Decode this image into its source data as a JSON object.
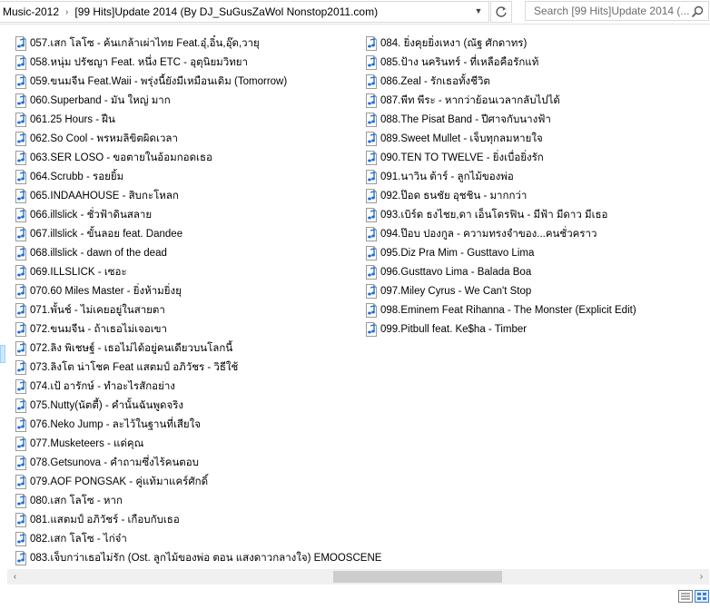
{
  "address": {
    "crumbs": [
      "Music-2012",
      "[99 Hits]Update 2014 (By DJ_SuGusZaWol Nonstop2011.com)"
    ],
    "separator": "›",
    "dropdown_icon": "chevron-down-icon",
    "refresh_icon": "refresh-icon"
  },
  "search": {
    "placeholder": "Search [99 Hits]Update 2014 (..."
  },
  "files_col1": [
    "057.เสก โลโซ - ค้นเกล้าเผ่าไทย Feat.อุ๋,อิ๋น,อุ๊ด,วายุ",
    "058.หนุ่ม ปรัชญา  Feat. หนึ่ง ETC - อุตุนิยมวิทยา",
    "059.ขนมจีน Feat.Waii - พรุ่งนี้ยังมีเหมือนเดิม (Tomorrow)",
    "060.Superband - มัน ใหญ่ มาก",
    "061.25 Hours - ฝืน",
    "062.So Cool - พรหมลิขิตผิดเวลา",
    "063.SER LOSO - ขอตายในอ้อมกอดเธอ",
    "064.Scrubb - รอยยิ้ม",
    "065.INDAAHOUSE - สิบกะโหลก",
    "066.illslick - ชั่วฟ้าดินสลาย",
    "067.illslick - ขั้นลอย feat. Dandee",
    "068.illslick - dawn of the dead",
    "069.ILLSLICK - เซอะ",
    "070.60 Miles Master - ยิ่งห้ามยิ่งยุ",
    "071.พั้นช์ - ไม่เคยอยู่ในสายตา",
    "072.ขนมจีน - ถ้าเธอไม่เจอเขา",
    "072.ลิง พิเชษฐ์ - เธอไม่ได้อยู่คนเดียวบนโลกนี้",
    "073.ลิงโต น่าโชค Feat แสตมป์ อภิวัชร - วิธีใช้",
    "074.เป้ อารักษ์ - ทำอะไรสักอย่าง",
    "075.Nutty(นัตตี้) - คำนั้นฉันพูดจริง",
    "076.Neko Jump - ละไว้ในฐานที่เสียใจ",
    "077.Musketeers - แด่คุณ",
    "078.Getsunova - คำถามซึ่งไร้คนตอบ",
    "079.AOF PONGSAK - คู่แท้มาแคร์ศักดิ์",
    "080.เสก โลโซ - หาก",
    "081.แสตมป์ อภิวัชร์ - เกือบกับเธอ",
    "082.เสก โลโซ - ไก่จ๋า",
    "083.เจ็บกว่าเธอไม่รัก (Ost. ลูกไม้ของพ่อ ตอน แสงดาวกลางใจ)  EMOOSCENE"
  ],
  "files_col2": [
    "084. ยิ่งคุยยิ่งเหงา (ณัฐ ศักดาทร)",
    "085.ป้าง นครินทร์ - ที่เหลือคือรักแท้",
    "086.Zeal - รักเธอทั้งชีวิต",
    "087.พีท พีระ - หากว่าย้อนเวลากลับไปได้",
    "088.The Pisat Band - ปีศาจกับนางฟ้า",
    "089.Sweet Mullet - เจ็บทุกลมหายใจ",
    "090.TEN TO TWELVE - ยิ่งเบื่อยิ่งรัก",
    "091.นาวิน ต้าร์ - ลูกไม้ของพ่อ",
    "092.ป๊อด ธนชัย อุชชิน - มากกว่า",
    "093.เบิร์ด ธงไชย,ดา เอ็นโดรฟิน - มีฟ้า มีดาว มีเธอ",
    "094.ป๊อบ ปองกูล - ความทรงจำของ...คนชั่วคราว",
    "095.Diz Pra Mim - Gusttavo Lima",
    "096.Gusttavo Lima - Balada Boa",
    "097.Miley Cyrus - We Can't Stop",
    "098.Eminem Feat Rihanna - The Monster (Explicit Edit)",
    "099.Pitbull feat. Ke$ha - Timber"
  ],
  "file_icon": "audio-file-icon",
  "scrollbar": {
    "left_arrow": "‹",
    "right_arrow": "›"
  },
  "colors": {
    "selection": "#cce8ff",
    "icon_note": "#1c6fd6"
  }
}
